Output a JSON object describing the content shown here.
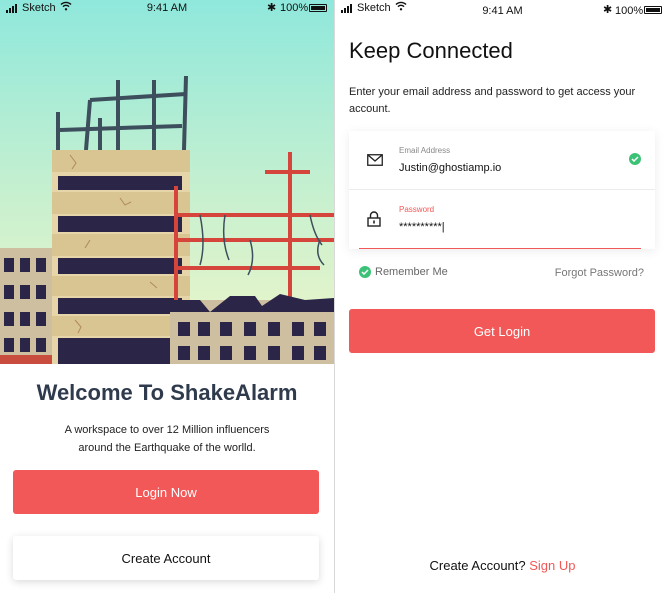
{
  "status_bar": {
    "carrier": "Sketch",
    "time": "9:41 AM",
    "battery": "100%",
    "icons": [
      "signal-icon",
      "wifi-icon",
      "bluetooth-icon",
      "battery-icon"
    ]
  },
  "welcome_screen": {
    "title": "Welcome To ShakeAlarm",
    "subtitle_line1": "A workspace to over 12 Million influencers",
    "subtitle_line2": "around the Earthquake of the worlld.",
    "login_button": "Login Now",
    "create_account_button": "Create Account"
  },
  "login_screen": {
    "title": "Keep Connected",
    "subtitle": "Enter your email address and password to get access your account.",
    "email": {
      "label": "Email Address",
      "value": "Justin@ghostiamp.io",
      "icon": "mail-icon",
      "valid": true
    },
    "password": {
      "label": "Password",
      "value": "**********|",
      "icon": "lock-icon"
    },
    "remember_me": "Remember Me",
    "remember_checked": true,
    "forgot_password": "Forgot Password?",
    "login_button": "Get Login",
    "signup_prompt": "Create Account?",
    "signup_link": "Sign Up"
  },
  "colors": {
    "accent": "#f25857",
    "success": "#3cc276",
    "title_dark": "#2f3b4d"
  }
}
